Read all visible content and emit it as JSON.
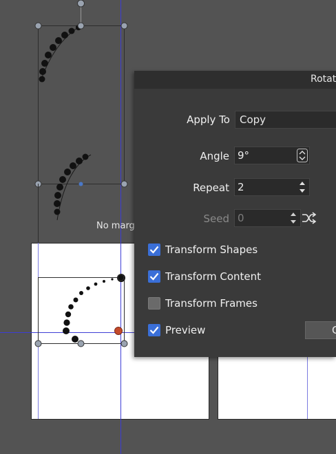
{
  "canvas": {
    "note": "No margi"
  },
  "dialog": {
    "title": "Rotat",
    "apply_to": {
      "label": "Apply To",
      "value": "Copy"
    },
    "angle": {
      "label": "Angle",
      "value": "9°"
    },
    "repeat": {
      "label": "Repeat",
      "value": "2"
    },
    "seed": {
      "label": "Seed",
      "value": "0"
    },
    "checkboxes": [
      {
        "label": "Transform Shapes",
        "checked": true
      },
      {
        "label": "Transform Content",
        "checked": true
      },
      {
        "label": "Transform Frames",
        "checked": false
      },
      {
        "label": "Preview",
        "checked": true
      }
    ],
    "button_label": "C"
  },
  "colors": {
    "workspace": "#535353",
    "dialog": "#3a3a3a",
    "checkbox_on": "#3a6fd8",
    "guide": "#3d3dd6",
    "center_marker": "#c44a2a"
  }
}
